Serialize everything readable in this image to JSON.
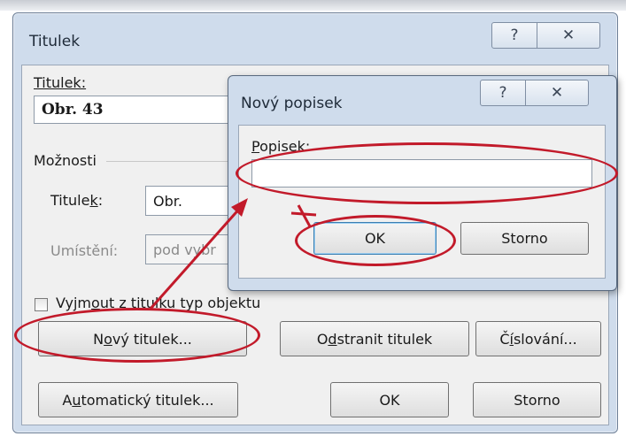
{
  "main_dialog": {
    "title": "Titulek",
    "help_symbol": "?",
    "close_symbol": "✕",
    "caption_label": "Titulek:",
    "caption_value": "Obr. 43",
    "options_label": "Možnosti",
    "label_field": {
      "prefix": "Tituleк",
      "label_text": "Titulek:",
      "value": "Obr."
    },
    "position_field": {
      "label_text": "Umístění:",
      "value": "pod vybr"
    },
    "exclude_label": {
      "before": "Vyjm",
      "accel": "o",
      "after": "ut z titulku typ objektu"
    },
    "buttons": {
      "new_label": {
        "before": "N",
        "accel": "o",
        "after": "vý titulek..."
      },
      "delete_label": {
        "before": "O",
        "accel": "d",
        "after": "stranit titulek"
      },
      "numbering": {
        "before": "Č",
        "accel": "í",
        "after": "slování..."
      },
      "autocaption": {
        "before": "A",
        "accel": "u",
        "after": "tomatický titulek..."
      },
      "ok": "OK",
      "cancel": "Storno"
    }
  },
  "sub_dialog": {
    "title": "Nový popisek",
    "help_symbol": "?",
    "close_symbol": "✕",
    "field_label": {
      "accel": "P",
      "after": "opisek:"
    },
    "field_value": "",
    "ok": "OK",
    "cancel": "Storno"
  },
  "annotation_color": "#c21a2a",
  "icons": [
    "help-icon",
    "close-icon",
    "checkbox-icon",
    "arrow-annotation"
  ]
}
